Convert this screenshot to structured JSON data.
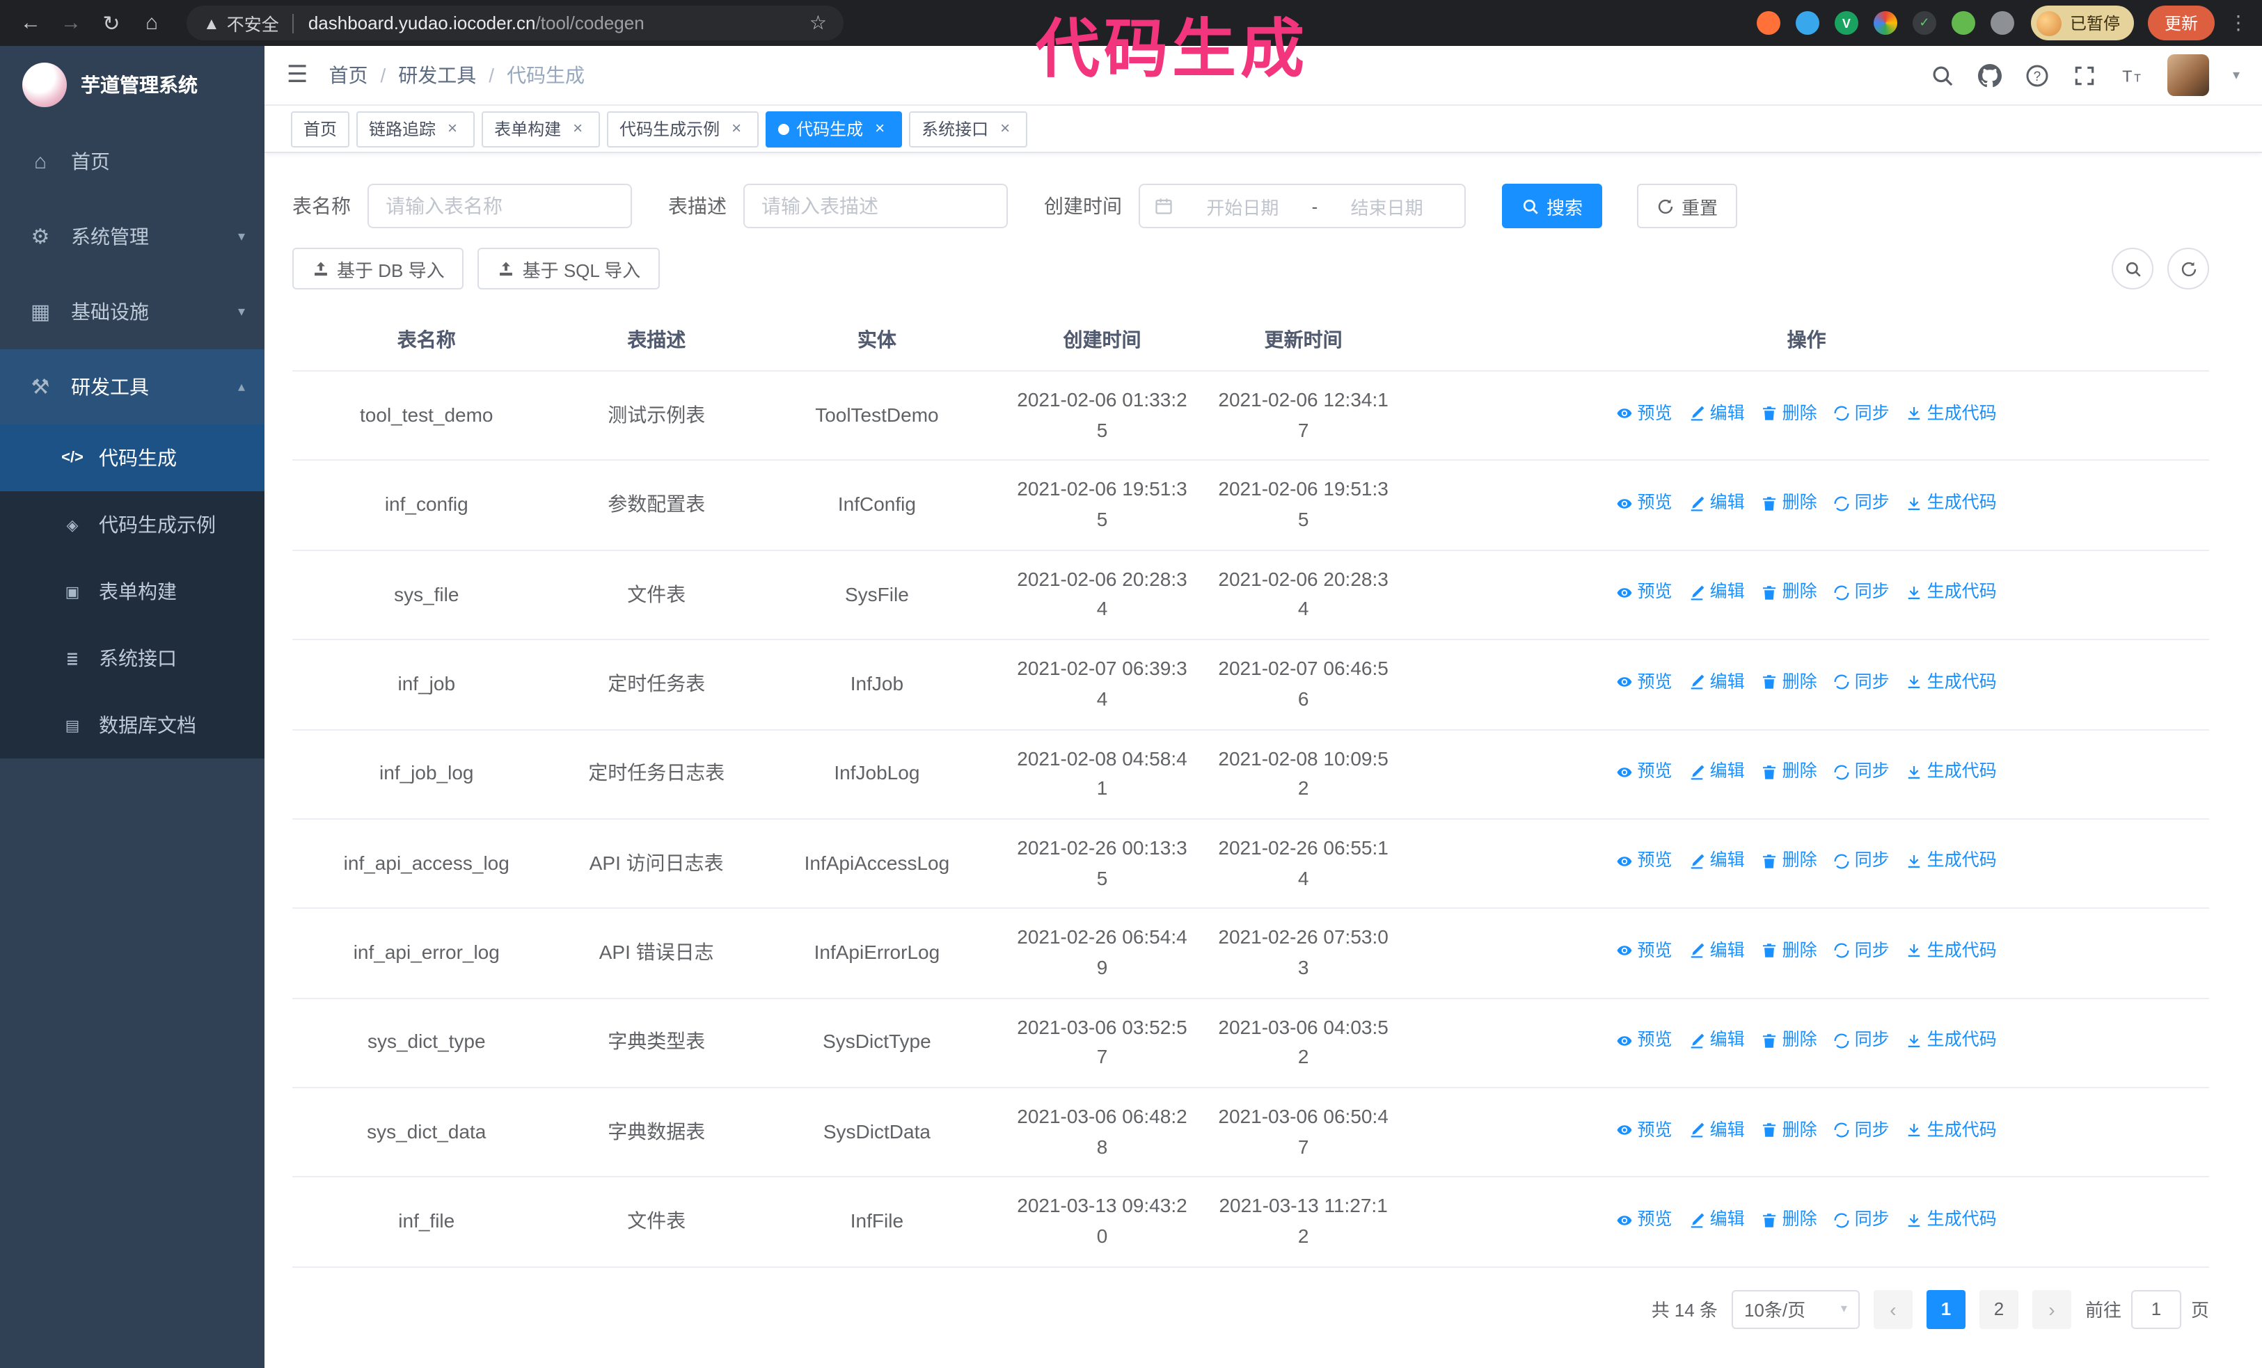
{
  "browser": {
    "security_label": "不安全",
    "url_host": "dashboard.yudao.iocoder.cn",
    "url_path": "/tool/codegen",
    "paused_badge": "已暂停",
    "update_button": "更新"
  },
  "annotation": {
    "text": "代码生成"
  },
  "sidebar": {
    "logo_title": "芋道管理系统",
    "menu": [
      {
        "label": "首页"
      },
      {
        "label": "系统管理"
      },
      {
        "label": "基础设施"
      },
      {
        "label": "研发工具"
      }
    ],
    "submenu": [
      {
        "label": "代码生成"
      },
      {
        "label": "代码生成示例"
      },
      {
        "label": "表单构建"
      },
      {
        "label": "系统接口"
      },
      {
        "label": "数据库文档"
      }
    ]
  },
  "header": {
    "breadcrumb": [
      "首页",
      "研发工具",
      "代码生成"
    ],
    "separator": "/"
  },
  "tabs": [
    {
      "label": "首页"
    },
    {
      "label": "链路追踪"
    },
    {
      "label": "表单构建"
    },
    {
      "label": "代码生成示例"
    },
    {
      "label": "代码生成"
    },
    {
      "label": "系统接口"
    }
  ],
  "filters": {
    "name_label": "表名称",
    "name_placeholder": "请输入表名称",
    "desc_label": "表描述",
    "desc_placeholder": "请输入表描述",
    "time_label": "创建时间",
    "start_placeholder": "开始日期",
    "range_separator": "-",
    "end_placeholder": "结束日期",
    "search_button": "搜索",
    "reset_button": "重置"
  },
  "toolbar": {
    "import_db_button": "基于 DB 导入",
    "import_sql_button": "基于 SQL 导入"
  },
  "table": {
    "columns": [
      "表名称",
      "表描述",
      "实体",
      "创建时间",
      "更新时间",
      "操作"
    ],
    "row_actions": [
      "预览",
      "编辑",
      "删除",
      "同步",
      "生成代码"
    ],
    "rows": [
      {
        "name": "tool_test_demo",
        "desc": "测试示例表",
        "entity": "ToolTestDemo",
        "created": "2021-02-06 01:33:25",
        "updated": "2021-02-06 12:34:17"
      },
      {
        "name": "inf_config",
        "desc": "参数配置表",
        "entity": "InfConfig",
        "created": "2021-02-06 19:51:35",
        "updated": "2021-02-06 19:51:35"
      },
      {
        "name": "sys_file",
        "desc": "文件表",
        "entity": "SysFile",
        "created": "2021-02-06 20:28:34",
        "updated": "2021-02-06 20:28:34"
      },
      {
        "name": "inf_job",
        "desc": "定时任务表",
        "entity": "InfJob",
        "created": "2021-02-07 06:39:34",
        "updated": "2021-02-07 06:46:56"
      },
      {
        "name": "inf_job_log",
        "desc": "定时任务日志表",
        "entity": "InfJobLog",
        "created": "2021-02-08 04:58:41",
        "updated": "2021-02-08 10:09:52"
      },
      {
        "name": "inf_api_access_log",
        "desc": "API 访问日志表",
        "entity": "InfApiAccessLog",
        "created": "2021-02-26 00:13:35",
        "updated": "2021-02-26 06:55:14"
      },
      {
        "name": "inf_api_error_log",
        "desc": "API 错误日志",
        "entity": "InfApiErrorLog",
        "created": "2021-02-26 06:54:49",
        "updated": "2021-02-26 07:53:03"
      },
      {
        "name": "sys_dict_type",
        "desc": "字典类型表",
        "entity": "SysDictType",
        "created": "2021-03-06 03:52:57",
        "updated": "2021-03-06 04:03:52"
      },
      {
        "name": "sys_dict_data",
        "desc": "字典数据表",
        "entity": "SysDictData",
        "created": "2021-03-06 06:48:28",
        "updated": "2021-03-06 06:50:47"
      },
      {
        "name": "inf_file",
        "desc": "文件表",
        "entity": "InfFile",
        "created": "2021-03-13 09:43:20",
        "updated": "2021-03-13 11:27:12"
      }
    ]
  },
  "pagination": {
    "total": "共 14 条",
    "page_size": "10条/页",
    "pages": [
      "1",
      "2"
    ],
    "goto_label": "前往",
    "goto_value": "1",
    "goto_suffix": "页"
  },
  "colors": {
    "primary": "#1890ff",
    "annotation": "#f2357d",
    "sidebar_bg": "#304156",
    "submenu_bg": "#1f2d3d"
  }
}
